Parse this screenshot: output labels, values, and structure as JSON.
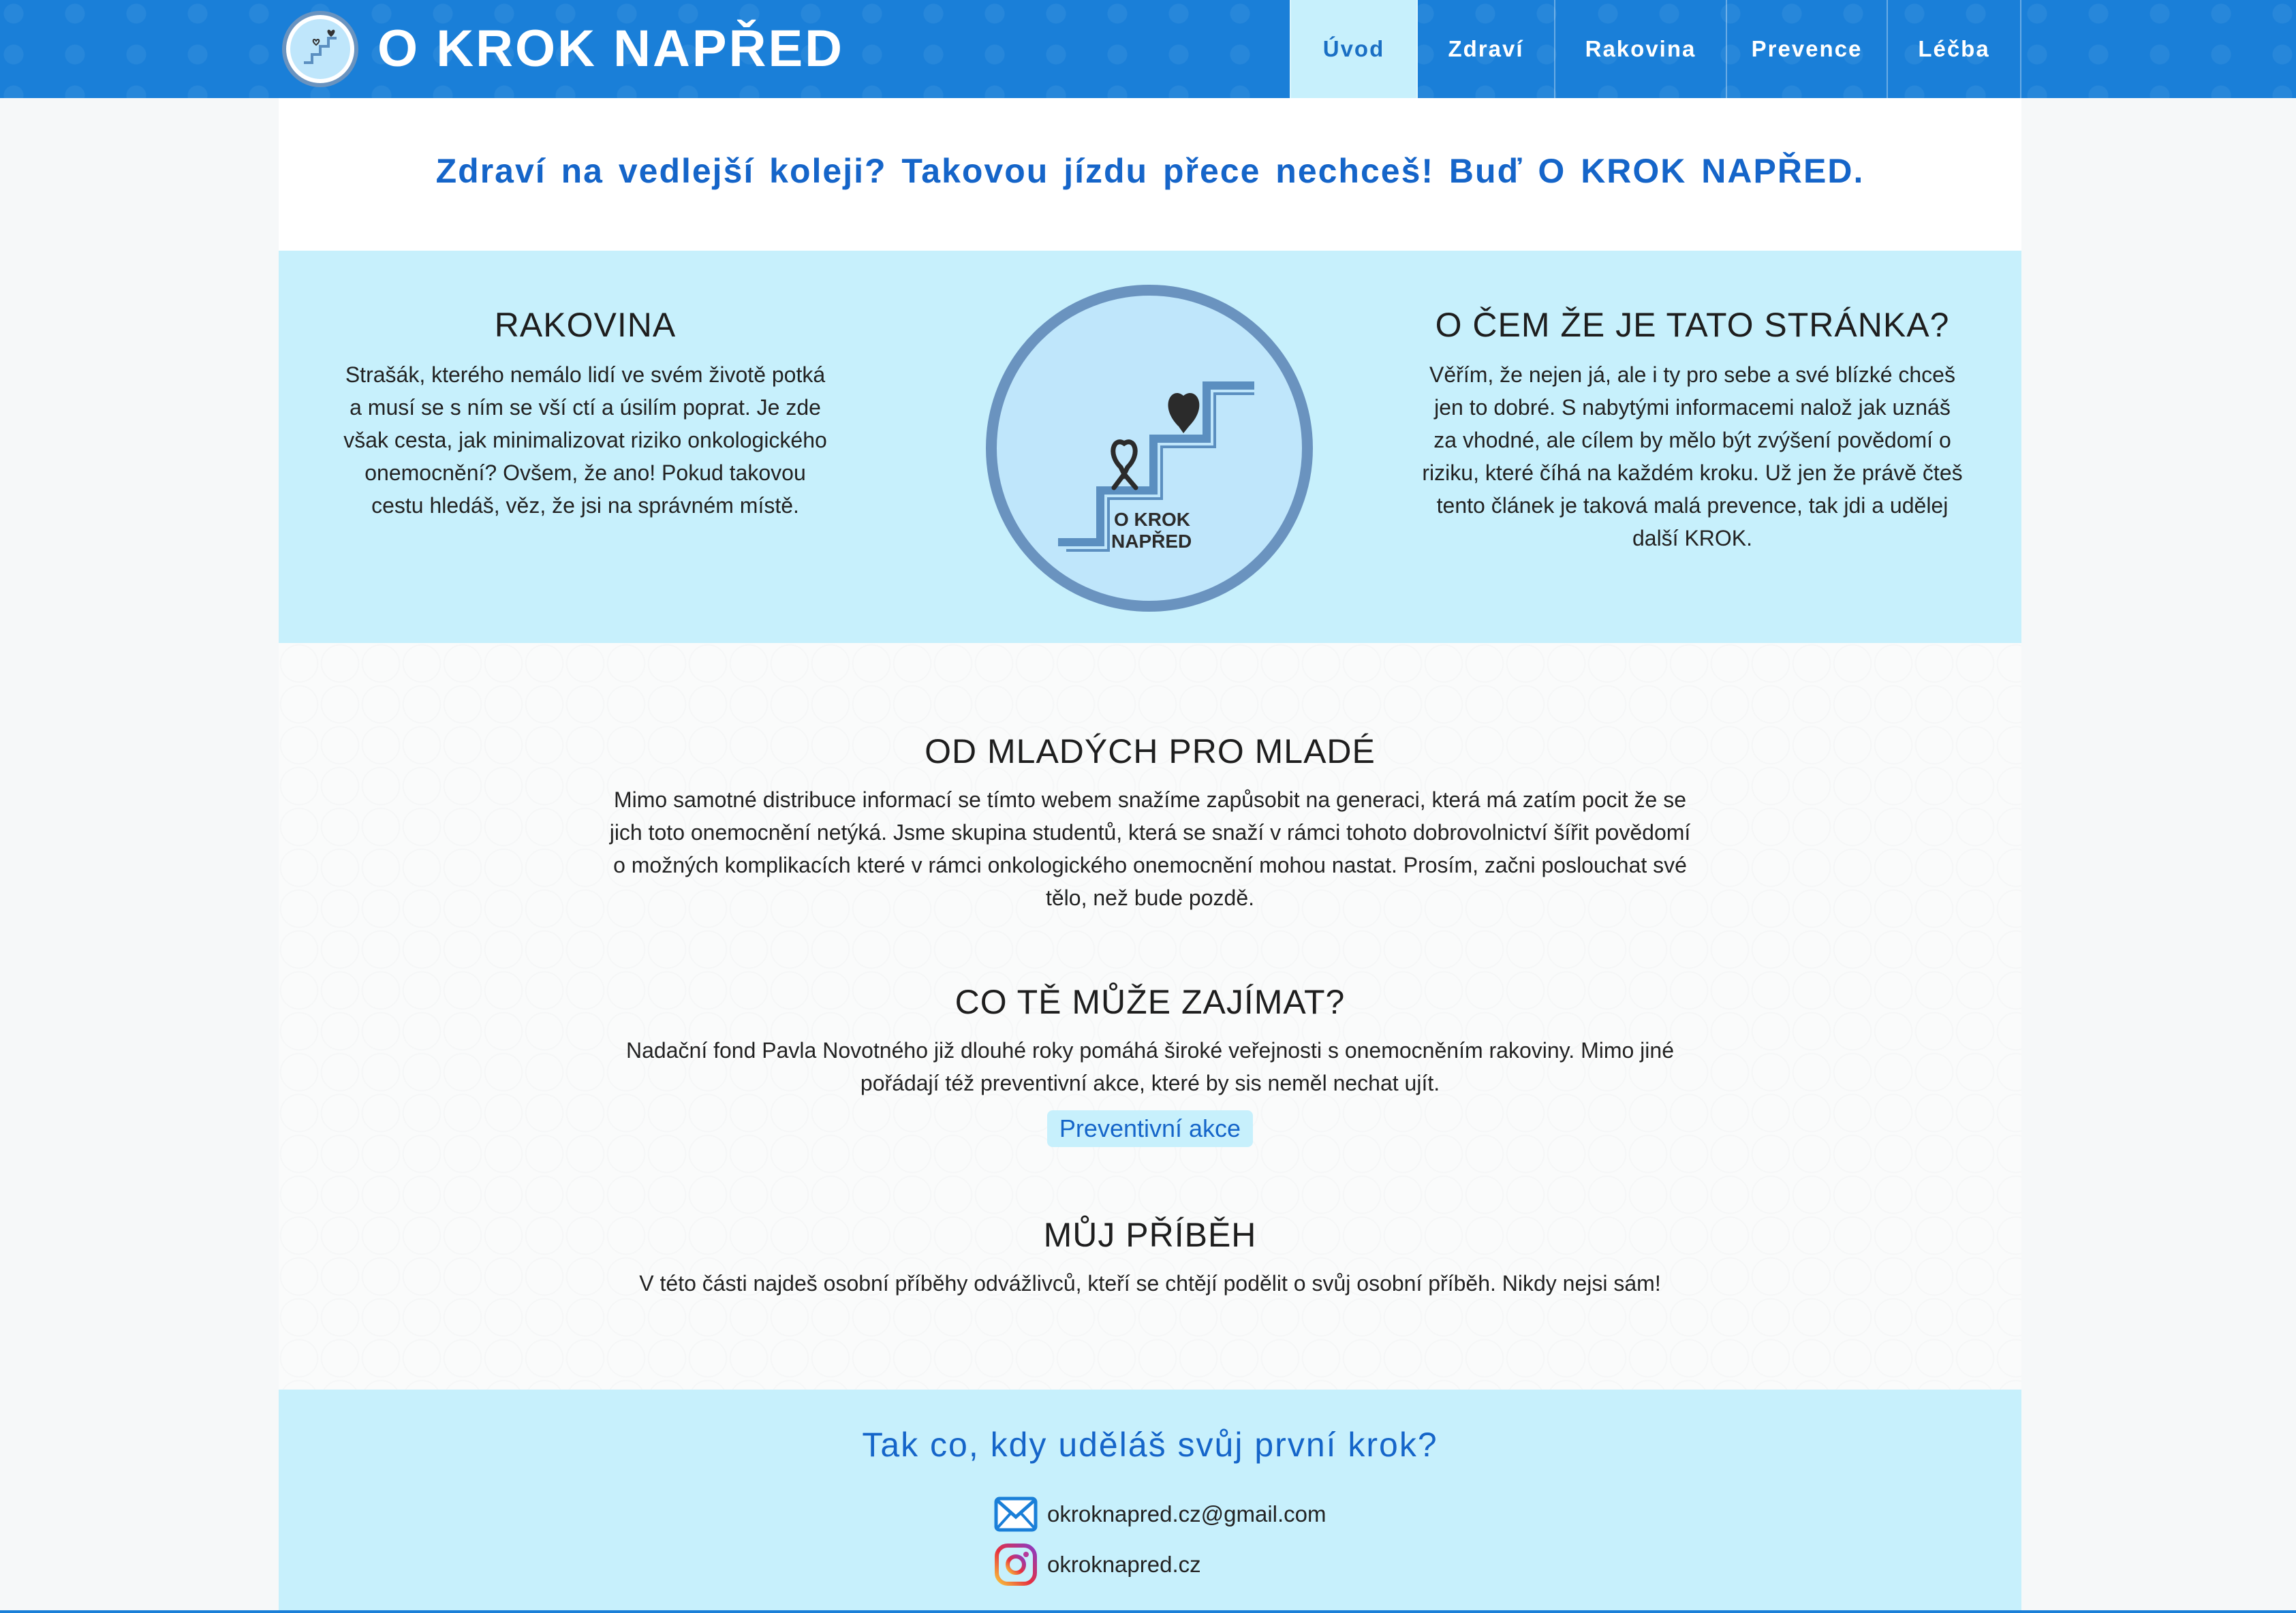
{
  "header": {
    "brand": "O KROK NAPŘED",
    "nav": [
      {
        "label": "Úvod",
        "active": true
      },
      {
        "label": "Zdraví",
        "active": false
      },
      {
        "label": "Rakovina",
        "active": false
      },
      {
        "label": "Prevence",
        "active": false
      },
      {
        "label": "Léčba",
        "active": false
      }
    ]
  },
  "tagline": "Zdraví na vedlejší koleji?  Takovou jízdu přece nechceš!  Buď O KROK NAPŘED.",
  "hero": {
    "left": {
      "title": "RAKOVINA",
      "text": "Strašák, kterého nemálo lidí ve svém životě potká a musí se s ním se vší ctí a úsilím poprat. Je zde však cesta, jak minimalizovat riziko onkologického onemocnění? Ovšem, že ano! Pokud takovou cestu hledáš, věz, že jsi na správném místě."
    },
    "logo_text_1": "O KROK",
    "logo_text_2": "NAPŘED",
    "right": {
      "title": "O ČEM ŽE JE TATO STRÁNKA?",
      "text": "Věřím, že nejen já, ale i ty pro sebe a své blízké chceš jen to dobré. S nabytými informacemi nalož jak uznáš za vhodné, ale cílem by mělo být zvýšení povědomí o riziku, které číhá na každém kroku. Už jen že právě čteš tento článek je taková malá prevence, tak jdi a udělej další KROK."
    }
  },
  "sections": {
    "young": {
      "title": "OD MLADÝCH PRO MLADÉ",
      "text": "Mimo samotné distribuce informací se tímto webem snažíme zapůsobit na generaci, která má zatím pocit že se jich toto onemocnění netýká. Jsme skupina studentů, která se snaží v rámci tohoto dobrovolnictví šířit povědomí o možných komplikacích které v rámci onkologického onemocnění mohou nastat. Prosím, začni poslouchat své tělo, než bude pozdě."
    },
    "interest": {
      "title": "CO TĚ MŮŽE ZAJÍMAT?",
      "text": "Nadační fond Pavla Novotného již dlouhé roky pomáhá široké veřejnosti s onemocněním rakoviny. Mimo jiné pořádají též preventivní akce, které by sis neměl nechat ujít.",
      "button": "Preventivní akce"
    },
    "story": {
      "title": "MŮJ PŘÍBĚH",
      "text": "V této části najdeš osobní příběhy odvážlivců, kteří se chtějí podělit o svůj osobní příběh. Nikdy nejsi sám!"
    }
  },
  "footer": {
    "title": "Tak co, kdy uděláš svůj první krok?",
    "email": "okroknapred.cz@gmail.com",
    "instagram": "okroknapred.cz"
  },
  "colors": {
    "header_blue": "#1a7fd8",
    "light_cyan": "#c7f0fc",
    "link_blue": "#1565c9",
    "logo_ring": "#6a93bf"
  }
}
